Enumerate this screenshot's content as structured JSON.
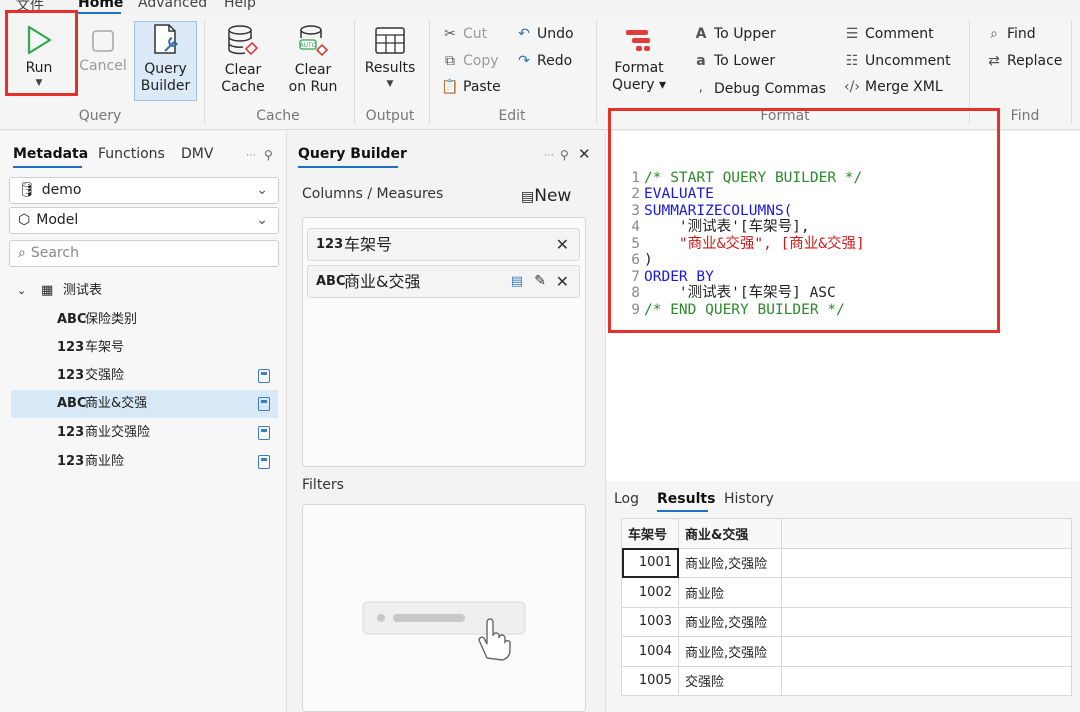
{
  "menu": {
    "file": "文件",
    "home": "Home",
    "advanced": "Advanced",
    "help": "Help"
  },
  "ribbon": {
    "run": "Run",
    "cancel": "Cancel",
    "query_builder": [
      "Query",
      "Builder"
    ],
    "clear_cache": [
      "Clear",
      "Cache"
    ],
    "clear_on_run": [
      "Clear",
      "on Run"
    ],
    "results": "Results",
    "cut": "Cut",
    "copy": "Copy",
    "paste": "Paste",
    "undo": "Undo",
    "redo": "Redo",
    "format_query": [
      "Format",
      "Query ▾"
    ],
    "to_upper": "To Upper",
    "to_lower": "To Lower",
    "debug_commas": "Debug Commas",
    "comment": "Comment",
    "uncomment": "Uncomment",
    "merge_xml": "Merge XML",
    "find": "Find",
    "replace": "Replace",
    "groups": {
      "query": "Query",
      "cache": "Cache",
      "output": "Output",
      "edit": "Edit",
      "format": "Format",
      "find": "Find"
    }
  },
  "metadata": {
    "tabs": [
      "Metadata",
      "Functions",
      "DMV"
    ],
    "database": "demo",
    "model": "Model",
    "search_placeholder": "Search",
    "table_name": "测试表",
    "columns": [
      {
        "type": "ABC",
        "name": "保险类别",
        "calc": false
      },
      {
        "type": "123",
        "name": "车架号",
        "calc": false
      },
      {
        "type": "123",
        "name": "交强险",
        "calc": true
      },
      {
        "type": "ABC",
        "name": "商业&交强",
        "calc": true,
        "selected": true
      },
      {
        "type": "123",
        "name": "商业交强险",
        "calc": true
      },
      {
        "type": "123",
        "name": "商业险",
        "calc": true
      }
    ]
  },
  "query_builder": {
    "title": "Query Builder",
    "columns_measures": "Columns / Measures",
    "new": "New",
    "items": [
      {
        "type": "123",
        "name": "车架号"
      },
      {
        "type": "ABC",
        "name": "商业&交强"
      }
    ],
    "filters": "Filters"
  },
  "editor": {
    "lines": [
      "/* START QUERY BUILDER */",
      "EVALUATE",
      "SUMMARIZECOLUMNS(",
      "    '测试表'[车架号],",
      "    \"商业&交强\", [商业&交强]",
      ")",
      "ORDER BY",
      "    '测试表'[车架号] ASC",
      "/* END QUERY BUILDER */"
    ]
  },
  "results": {
    "tabs": [
      "Log",
      "Results",
      "History"
    ],
    "headers": [
      "车架号",
      "商业&交强"
    ],
    "rows": [
      [
        "1001",
        "商业险,交强险"
      ],
      [
        "1002",
        "商业险"
      ],
      [
        "1003",
        "商业险,交强险"
      ],
      [
        "1004",
        "商业险,交强险"
      ],
      [
        "1005",
        "交强险"
      ]
    ]
  },
  "colors": {
    "accent": "#1f6fc5",
    "highlight": "#e8302b",
    "run": "#2fa84f"
  }
}
